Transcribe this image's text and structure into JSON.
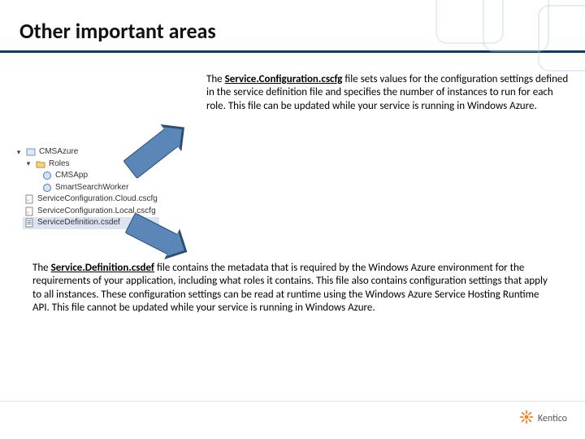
{
  "header": {
    "title": "Other important areas"
  },
  "top_paragraph": {
    "prefix": "The ",
    "filename": "Service.Configuration.cscfg",
    "rest": " file sets values for the configuration settings defined in the service definition file and specifies the number of instances to run for each role. This file can be updated while your service is running in Windows Azure."
  },
  "tree": {
    "root": "CMSAzure",
    "folder": "Roles",
    "role1": "CMSApp",
    "role2": "SmartSearchWorker",
    "cfg_cloud": "ServiceConfiguration.Cloud.cscfg",
    "cfg_local": "ServiceConfiguration.Local.cscfg",
    "def": "ServiceDefinition.csdef"
  },
  "bottom_paragraph": {
    "prefix": "The ",
    "filename": "Service.Definition.csdef",
    "rest": " file contains the metadata that is required by the Windows Azure environment for the requirements of your application, including what roles it contains. This file also contains configuration settings that apply to all instances. These configuration settings can be read at runtime using the Windows Azure Service Hosting Runtime API. This file cannot be updated while your service is running in Windows Azure."
  },
  "footer": {
    "brand": "Kentico"
  }
}
